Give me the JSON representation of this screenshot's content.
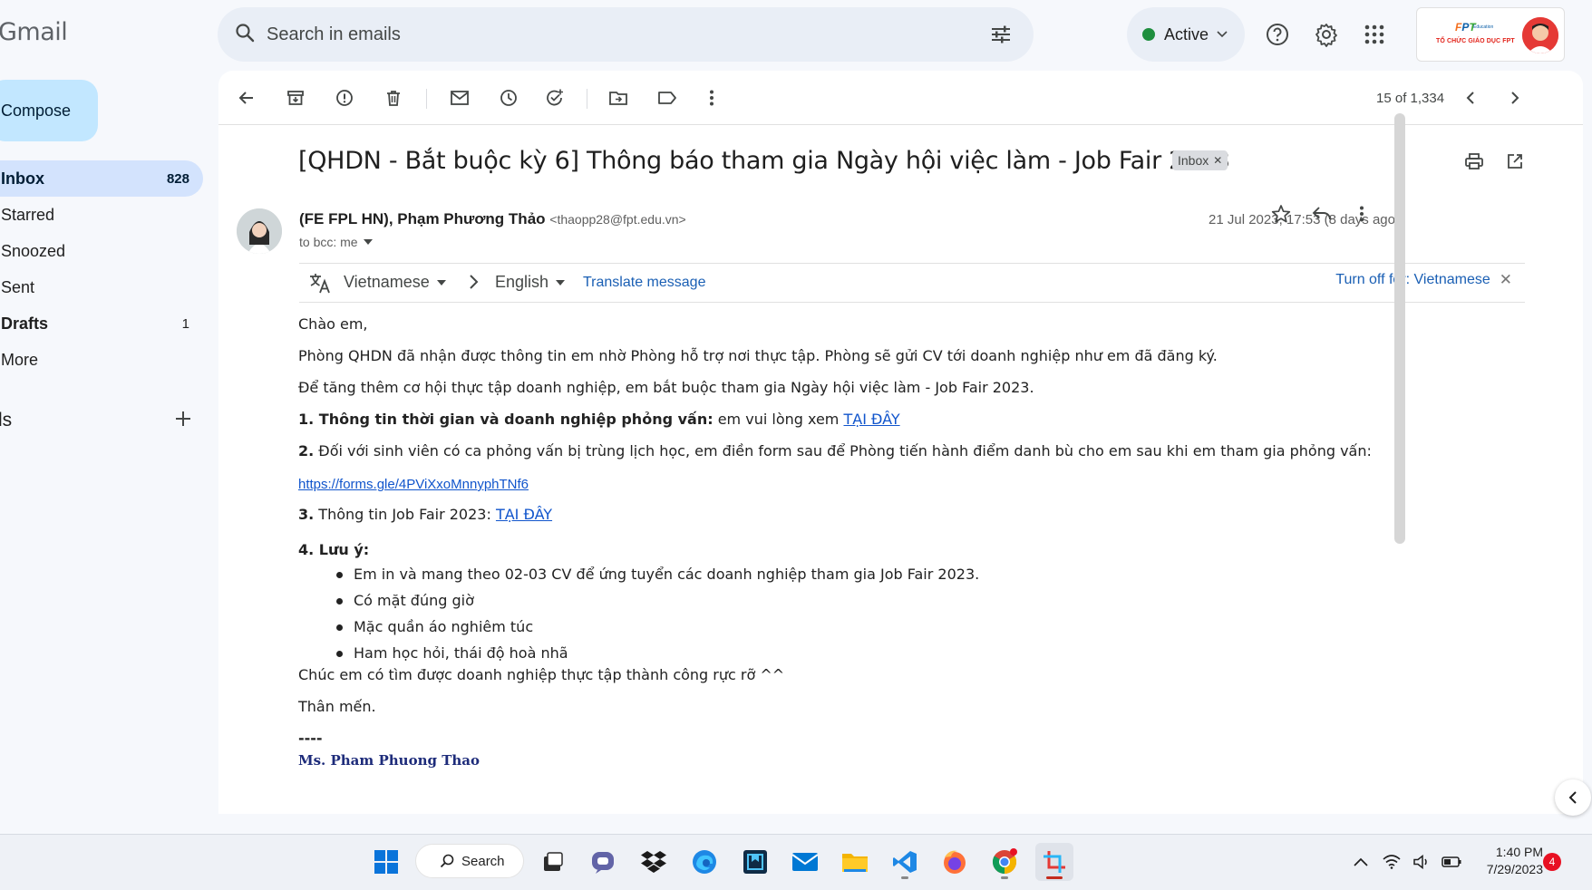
{
  "app": {
    "logo": "Gmail"
  },
  "search": {
    "placeholder": "Search in emails"
  },
  "status": {
    "label": "Active",
    "color": "#1e8e3e"
  },
  "account": {
    "org_tagline": "TỔ CHỨC GIÁO DỤC FPT",
    "org_mark": "FPT",
    "org_sub": "Education"
  },
  "compose": {
    "label": "Compose"
  },
  "nav": [
    {
      "label": "Inbox",
      "count": "828"
    },
    {
      "label": "Starred",
      "count": ""
    },
    {
      "label": "Snoozed",
      "count": ""
    },
    {
      "label": "Sent",
      "count": ""
    },
    {
      "label": "Drafts",
      "count": "1"
    },
    {
      "label": "More",
      "count": ""
    }
  ],
  "labels_header": "ls",
  "pager": {
    "text": "15 of 1,334"
  },
  "email": {
    "subject": "[QHDN - Bắt buộc kỳ 6] Thông báo tham gia Ngày hội việc làm - Job Fair 2023",
    "label_chip": "Inbox",
    "sender_name": "(FE FPL HN), Phạm Phương Thảo",
    "sender_email": "<thaopp28@fpt.edu.vn>",
    "to": "to bcc: me",
    "date": "21 Jul 2023, 17:53 (8 days ago)"
  },
  "translate": {
    "from": "Vietnamese",
    "to": "English",
    "action": "Translate message",
    "turn_off": "Turn off for: Vietnamese"
  },
  "body": {
    "greeting": "Chào em,",
    "p1": "Phòng QHDN đã nhận được thông tin em nhờ Phòng hỗ trợ nơi thực tập. Phòng sẽ gửi CV tới doanh nghiệp như em đã đăng ký.",
    "p2": "Để tăng thêm cơ hội thực tập doanh nghiệp, em bắt buộc tham gia Ngày hội việc làm - Job Fair 2023.",
    "s1_bold": "1. Thông tin thời gian và doanh nghiệp phỏng vấn:",
    "s1_text": " em vui lòng xem ",
    "s1_link": "TẠI ĐÂY",
    "s2_bold": "2.",
    "s2_text": " Đối với sinh viên có ca phỏng vấn bị trùng lịch học, em điền form sau để Phòng tiến hành điểm danh bù cho em sau khi em tham gia phỏng vấn:",
    "forms_link": "https://forms.gle/4PViXxoMnnyphTNf6",
    "s3_bold": "3.",
    "s3_text": " Thông tin Job Fair 2023: ",
    "s3_link": "TẠI ĐÂY",
    "s4_bold": "4. Lưu ý:",
    "notes": [
      "Em in và mang theo 02-03 CV để ứng tuyển các doanh nghiệp tham gia Job Fair 2023.",
      "Có mặt đúng giờ",
      "Mặc quần áo nghiêm túc",
      "Ham học hỏi, thái độ hoà nhã"
    ],
    "closing": "Chúc em có tìm được doanh nghiệp thực tập thành công rực rỡ ^^",
    "signoff": "Thân mến.",
    "dashes": "----",
    "signature": "Ms. Pham Phuong Thao"
  },
  "taskbar": {
    "search_label": "Search",
    "time": "1:40 PM",
    "date": "7/29/2023",
    "notifications": "4"
  }
}
